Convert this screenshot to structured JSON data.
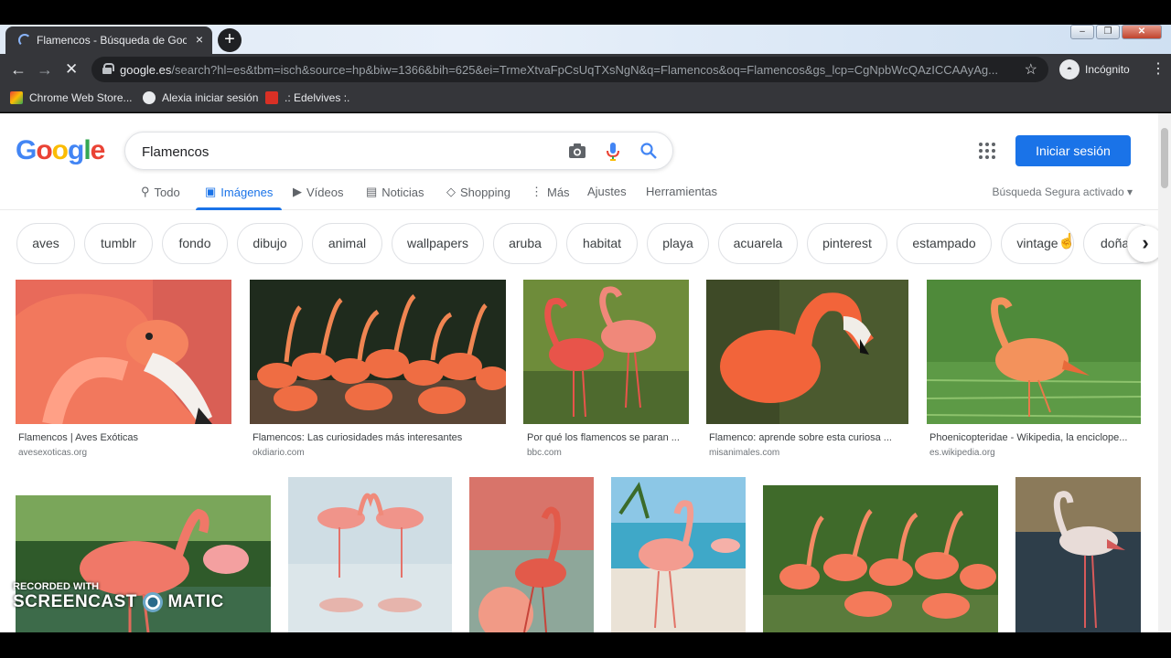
{
  "browser": {
    "tab_title": "Flamencos - Búsqueda de Google",
    "tab_close": "×",
    "new_tab": "+",
    "url_host": "google.es",
    "url_path": "/search?hl=es&tbm=isch&source=hp&biw=1366&bih=625&ei=TrmeXtvaFpCsUqTXsNgN&q=Flamencos&oq=Flamencos&gs_lcp=CgNpbWcQAzICCAAyAg...",
    "incognito_label": "Incógnito",
    "bookmarks": [
      "Chrome Web Store...",
      "Alexia iniciar sesión",
      ".: Edelvives :."
    ]
  },
  "google": {
    "logo": "Google",
    "logo_colors": [
      "#4285f4",
      "#ea4335",
      "#fbbc05",
      "#4285f4",
      "#34a853",
      "#ea4335"
    ],
    "query": "Flamencos",
    "signin": "Iniciar sesión",
    "accent": "#1a73e8",
    "tabs": [
      {
        "label": "Todo",
        "icon": "search-icon"
      },
      {
        "label": "Imágenes",
        "icon": "image-icon",
        "active": true
      },
      {
        "label": "Vídeos",
        "icon": "video-icon"
      },
      {
        "label": "Noticias",
        "icon": "news-icon"
      },
      {
        "label": "Shopping",
        "icon": "tag-icon"
      },
      {
        "label": "Más",
        "icon": "more-vert-icon"
      }
    ],
    "tools": [
      "Ajustes",
      "Herramientas"
    ],
    "safesearch": "Búsqueda Segura activado"
  },
  "chips": [
    "aves",
    "tumblr",
    "fondo",
    "dibujo",
    "animal",
    "wallpapers",
    "aruba",
    "habitat",
    "playa",
    "acuarela",
    "pinterest",
    "estampado",
    "vintage",
    "doñana"
  ],
  "results_row1": [
    {
      "title": "Flamencos | Aves Exóticas",
      "source": "avesexoticas.org"
    },
    {
      "title": "Flamencos: Las curiosidades más interesantes",
      "source": "okdiario.com"
    },
    {
      "title": "Por qué los flamencos se paran ...",
      "source": "bbc.com"
    },
    {
      "title": "Flamenco: aprende sobre esta curiosa ...",
      "source": "misanimales.com"
    },
    {
      "title": "Phoenicopteridae - Wikipedia, la enciclope...",
      "source": "es.wikipedia.org"
    }
  ],
  "watermark": {
    "line1": "RECORDED WITH",
    "line2": "SCREENCAST",
    "line3": "MATIC"
  }
}
